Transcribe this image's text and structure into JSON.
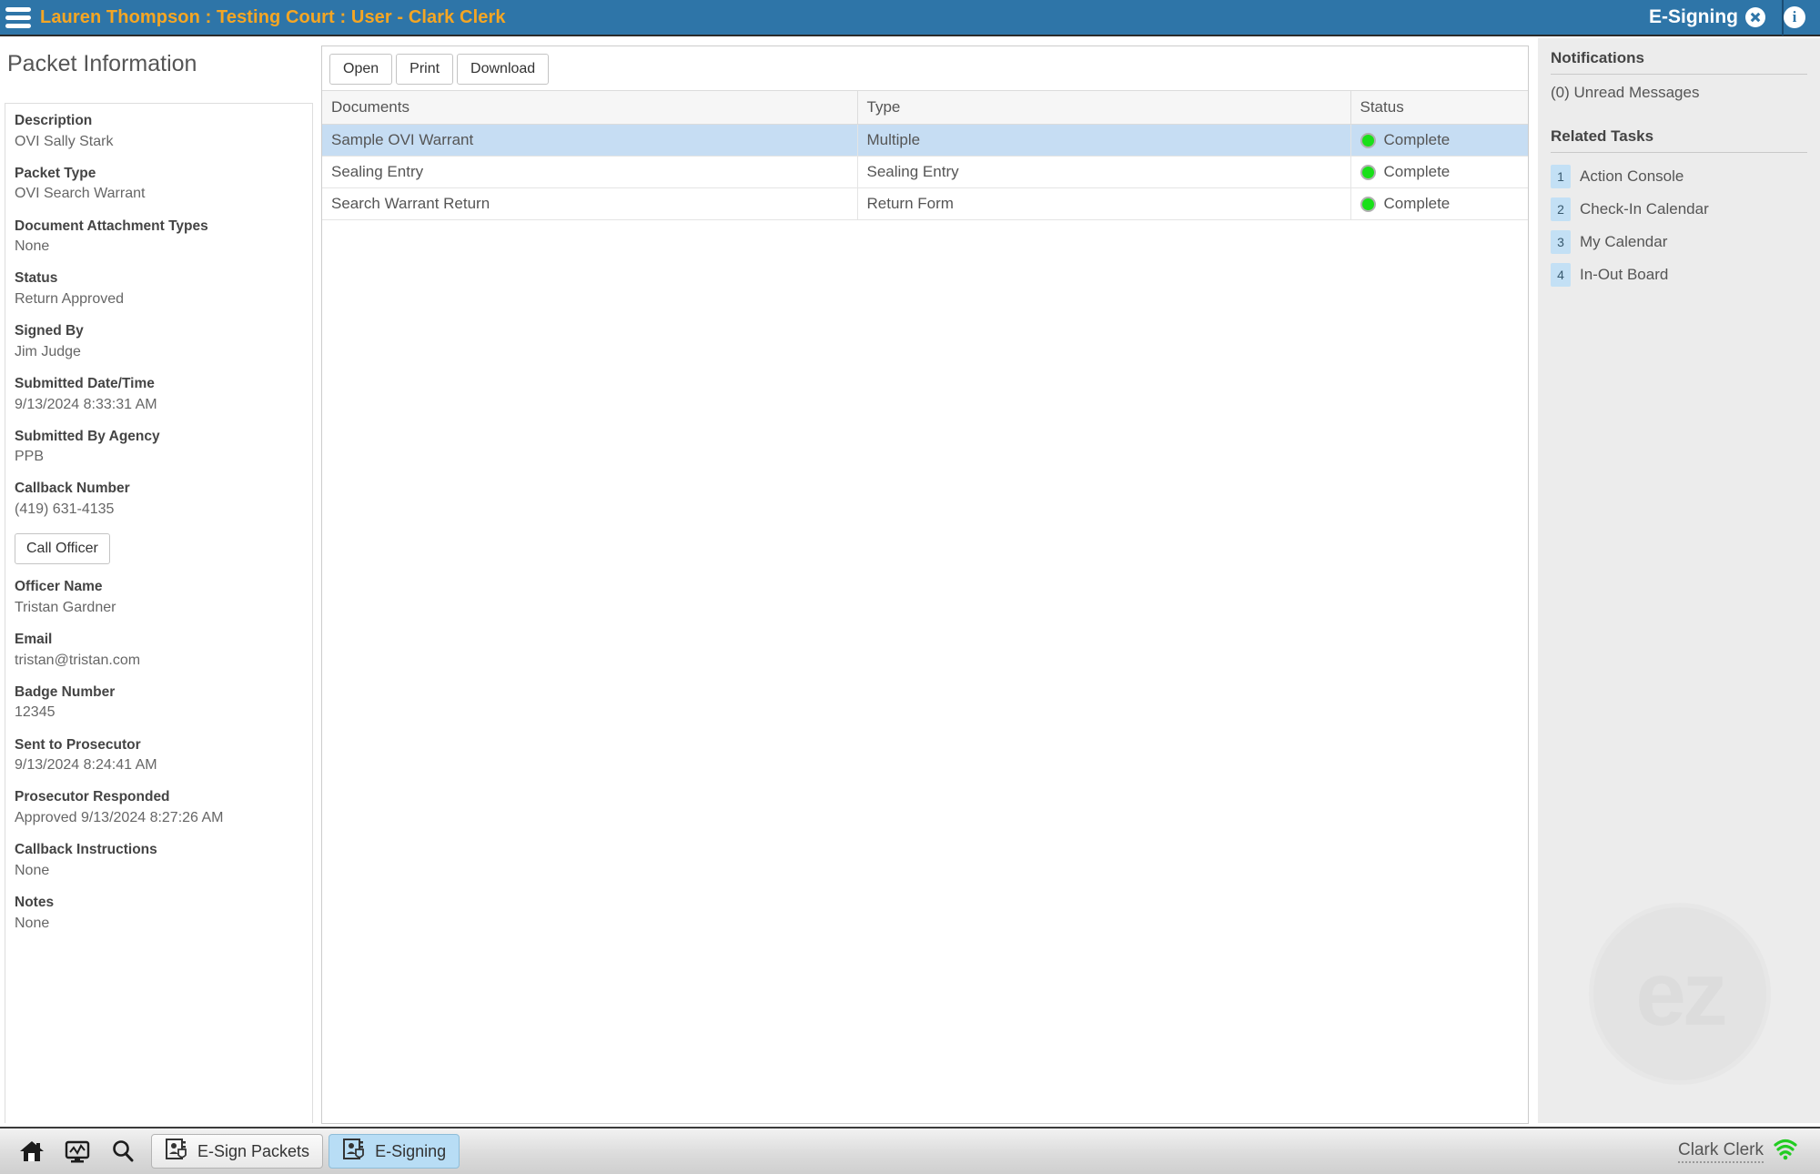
{
  "titlebar": {
    "menu_icon": "hamburger-icon",
    "breadcrumb": "Lauren Thompson : Testing Court : User - Clark Clerk",
    "tab_label": "E-Signing",
    "close_icon": "close-icon",
    "info_icon": "info-icon",
    "bar_color": "#2e75a8",
    "text_color": "#f5a623"
  },
  "left_panel": {
    "title": "Packet Information",
    "fields": [
      {
        "label": "Description",
        "value": "OVI Sally Stark"
      },
      {
        "label": "Packet Type",
        "value": "OVI Search Warrant"
      },
      {
        "label": "Document Attachment Types",
        "value": "None"
      },
      {
        "label": "Status",
        "value": "Return Approved"
      },
      {
        "label": "Signed By",
        "value": "Jim Judge"
      },
      {
        "label": "Submitted Date/Time",
        "value": "9/13/2024 8:33:31 AM"
      },
      {
        "label": "Submitted By Agency",
        "value": "PPB"
      },
      {
        "label": "Callback Number",
        "value": "(419) 631-4135"
      }
    ],
    "call_officer_button": "Call Officer",
    "fields_after": [
      {
        "label": "Officer Name",
        "value": "Tristan Gardner"
      },
      {
        "label": "Email",
        "value": "tristan@tristan.com"
      },
      {
        "label": "Badge Number",
        "value": "12345"
      },
      {
        "label": "Sent to Prosecutor",
        "value": "9/13/2024 8:24:41 AM"
      },
      {
        "label": "Prosecutor Responded",
        "value": "Approved 9/13/2024 8:27:26 AM"
      },
      {
        "label": "Callback Instructions",
        "value": "None"
      },
      {
        "label": "Notes",
        "value": "None"
      }
    ]
  },
  "content": {
    "toolbar": {
      "open": "Open",
      "print": "Print",
      "download": "Download"
    },
    "table": {
      "columns": [
        "Documents",
        "Type",
        "Status"
      ],
      "rows": [
        {
          "document": "Sample OVI Warrant",
          "type": "Multiple",
          "status": "Complete",
          "status_color": "#19e019",
          "selected": true
        },
        {
          "document": "Sealing Entry",
          "type": "Sealing Entry",
          "status": "Complete",
          "status_color": "#19e019",
          "selected": false
        },
        {
          "document": "Search Warrant Return",
          "type": "Return Form",
          "status": "Complete",
          "status_color": "#19e019",
          "selected": false
        }
      ]
    },
    "selected_row_color": "#c6ddf3"
  },
  "sidebar": {
    "notifications_heading": "Notifications",
    "unread_messages": "(0) Unread Messages",
    "related_tasks_heading": "Related Tasks",
    "tasks": [
      {
        "num": "1",
        "label": "Action Console"
      },
      {
        "num": "2",
        "label": "Check-In Calendar"
      },
      {
        "num": "3",
        "label": "My Calendar"
      },
      {
        "num": "4",
        "label": "In-Out Board"
      }
    ],
    "watermark_text": "ez"
  },
  "taskbar": {
    "icons": [
      "home-icon",
      "dashboard-icon",
      "search-icon"
    ],
    "buttons": [
      {
        "label": "E-Sign Packets",
        "icon": "contact-shield-icon",
        "active": false
      },
      {
        "label": "E-Signing",
        "icon": "contact-shield-icon",
        "active": true
      }
    ],
    "user_name": "Clark Clerk",
    "signal_icon": "wifi-icon"
  }
}
